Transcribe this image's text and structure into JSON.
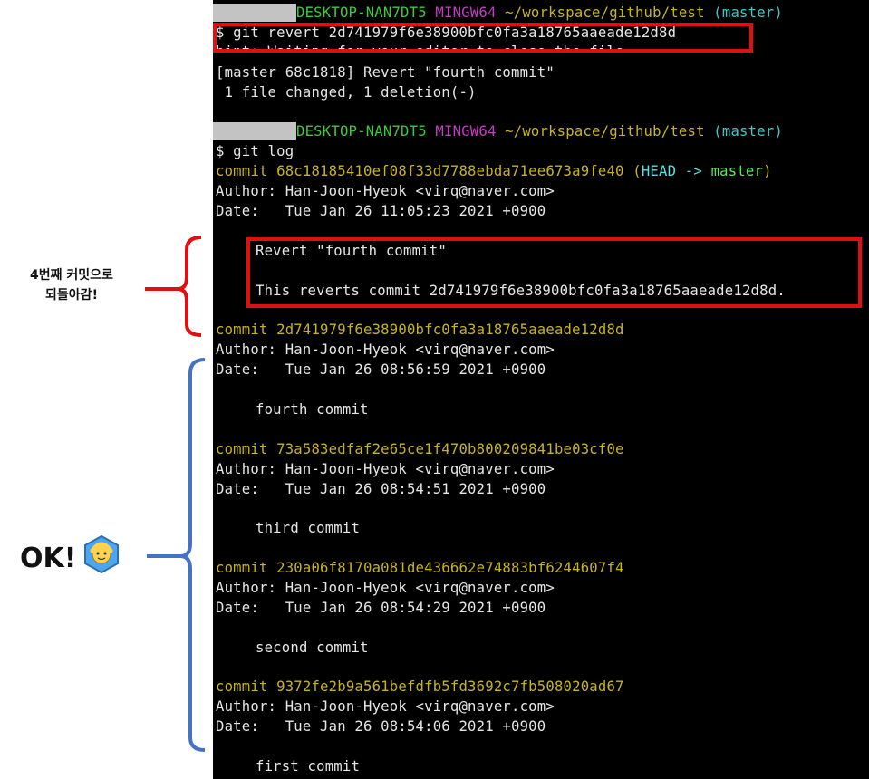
{
  "prompt": {
    "host": "DESKTOP-NAN7DT5",
    "shell": "MINGW64",
    "path": "~/workspace/github/test",
    "branch": "(master)"
  },
  "revert_command": "$ git revert 2d741979f6e38900bfc0fa3a18765aaeade12d8d",
  "hint_line": "hint: Waiting for your editor to close the file...",
  "revert_result": "[master 68c1818] Revert \"fourth commit\"",
  "changed_line": " 1 file changed, 1 deletion(-)",
  "log_command": "$ git log",
  "commits": [
    {
      "hash_line": "commit 68c18185410ef08f33d7788ebda71ee673a9fe40",
      "head_open": "(",
      "head": "HEAD ->",
      "branch": "master",
      "head_close": ")",
      "author": "Author: Han-Joon-Hyeok <virq@naver.com>",
      "date": "Date:   Tue Jan 26 11:05:23 2021 +0900",
      "message": "Revert \"fourth commit\"",
      "body": "This reverts commit 2d741979f6e38900bfc0fa3a18765aaeade12d8d."
    },
    {
      "hash_line": "commit 2d741979f6e38900bfc0fa3a18765aaeade12d8d",
      "author": "Author: Han-Joon-Hyeok <virq@naver.com>",
      "date": "Date:   Tue Jan 26 08:56:59 2021 +0900",
      "message": "fourth commit"
    },
    {
      "hash_line": "commit 73a583edfaf2e65ce1f470b800209841be03cf0e",
      "author": "Author: Han-Joon-Hyeok <virq@naver.com>",
      "date": "Date:   Tue Jan 26 08:54:51 2021 +0900",
      "message": "third commit"
    },
    {
      "hash_line": "commit 230a06f8170a081de436662e74883bf6244607f4",
      "author": "Author: Han-Joon-Hyeok <virq@naver.com>",
      "date": "Date:   Tue Jan 26 08:54:29 2021 +0900",
      "message": "second commit"
    },
    {
      "hash_line": "commit 9372fe2b9a561befdfb5fd3692c7fb508020ad67",
      "author": "Author: Han-Joon-Hyeok <virq@naver.com>",
      "date": "Date:   Tue Jan 26 08:54:06 2021 +0900",
      "message": "first commit"
    }
  ],
  "annotations": {
    "revert_note_line1": "4번째 커밋으로",
    "revert_note_line2": "되돌아감!",
    "ok_text": "OK!",
    "ok_icon": "ok-gesture-person-icon"
  },
  "colors": {
    "highlight_red": "#e01010",
    "bracket_blue": "#4472c4",
    "prompt_green": "#3fc93f",
    "prompt_magenta": "#c43cc4",
    "commit_yellow": "#c7b322",
    "branch_cyan": "#3ec7c7"
  }
}
